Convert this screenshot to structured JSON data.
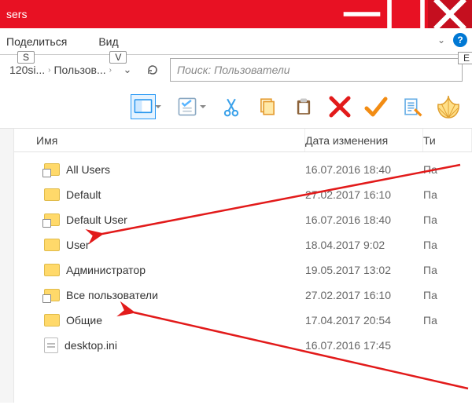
{
  "window": {
    "title": "sers"
  },
  "ribbon": {
    "tabs": [
      {
        "label": "Поделиться",
        "keytip": "S"
      },
      {
        "label": "Вид",
        "keytip": "V"
      }
    ],
    "keytip_right": "E"
  },
  "address": {
    "crumbs": [
      "120si...",
      "Пользов..."
    ],
    "search_placeholder": "Поиск: Пользователи"
  },
  "columns": {
    "name": "Имя",
    "date": "Дата изменения",
    "type": "Ти"
  },
  "files": [
    {
      "name": "All Users",
      "date": "16.07.2016 18:40",
      "type": "Па",
      "icon": "folder-shortcut"
    },
    {
      "name": "Default",
      "date": "27.02.2017 16:10",
      "type": "Па",
      "icon": "folder"
    },
    {
      "name": "Default User",
      "date": "16.07.2016 18:40",
      "type": "Па",
      "icon": "folder-shortcut"
    },
    {
      "name": "User",
      "date": "18.04.2017 9:02",
      "type": "Па",
      "icon": "folder"
    },
    {
      "name": "Администратор",
      "date": "19.05.2017 13:02",
      "type": "Па",
      "icon": "folder"
    },
    {
      "name": "Все пользователи",
      "date": "27.02.2017 16:10",
      "type": "Па",
      "icon": "folder-shortcut"
    },
    {
      "name": "Общие",
      "date": "17.04.2017 20:54",
      "type": "Па",
      "icon": "folder"
    },
    {
      "name": "desktop.ini",
      "date": "16.07.2016 17:45",
      "type": "",
      "icon": "ini"
    }
  ]
}
